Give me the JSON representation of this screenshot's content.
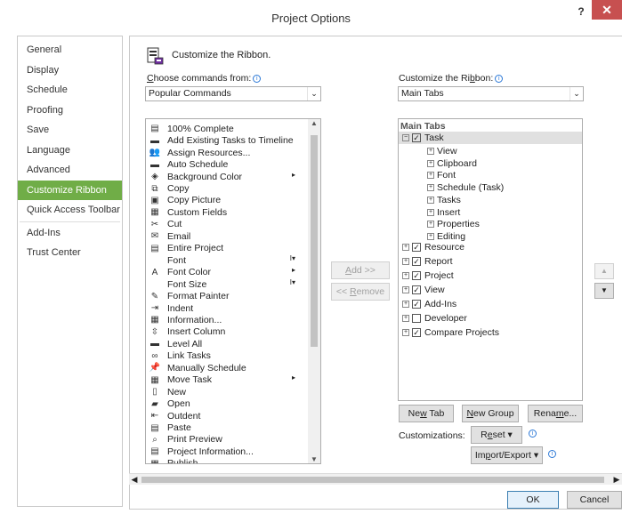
{
  "window": {
    "title": "Project Options",
    "help": "?",
    "close": "✕"
  },
  "nav": {
    "items": [
      "General",
      "Display",
      "Schedule",
      "Proofing",
      "Save",
      "Language",
      "Advanced",
      "Customize Ribbon",
      "Quick Access Toolbar",
      "Add-Ins",
      "Trust Center"
    ],
    "selected": "Customize Ribbon"
  },
  "header": {
    "title": "Customize the Ribbon."
  },
  "choose": {
    "label_pre": "",
    "label_u": "C",
    "label_post": "hoose commands from:",
    "info": "i",
    "value": "Popular Commands"
  },
  "customize": {
    "label_pre": "Customize the Ri",
    "label_u": "b",
    "label_post": "bon:",
    "info": "i",
    "value": "Main Tabs"
  },
  "commands": [
    {
      "label": "100% Complete",
      "icon": "progress-icon"
    },
    {
      "label": "Add Existing Tasks to Timeline",
      "icon": "timeline-icon"
    },
    {
      "label": "Assign Resources...",
      "icon": "resources-icon"
    },
    {
      "label": "Auto Schedule",
      "icon": "auto-schedule-icon"
    },
    {
      "label": "Background Color",
      "icon": "paint-bucket-icon",
      "sub": "▸"
    },
    {
      "label": "Copy",
      "icon": "copy-icon"
    },
    {
      "label": "Copy Picture",
      "icon": "copy-picture-icon"
    },
    {
      "label": "Custom Fields",
      "icon": "custom-fields-icon"
    },
    {
      "label": "Cut",
      "icon": "scissors-icon"
    },
    {
      "label": "Email",
      "icon": "email-icon"
    },
    {
      "label": "Entire Project",
      "icon": "entire-project-icon"
    },
    {
      "label": "Font",
      "icon": "font-icon",
      "sub": "I▾"
    },
    {
      "label": "Font Color",
      "icon": "font-color-icon",
      "sub": "▸"
    },
    {
      "label": "Font Size",
      "icon": "font-size-icon",
      "sub": "I▾"
    },
    {
      "label": "Format Painter",
      "icon": "format-painter-icon"
    },
    {
      "label": "Indent",
      "icon": "indent-icon"
    },
    {
      "label": "Information...",
      "icon": "information-icon"
    },
    {
      "label": "Insert Column",
      "icon": "insert-column-icon"
    },
    {
      "label": "Level All",
      "icon": "level-all-icon"
    },
    {
      "label": "Link Tasks",
      "icon": "link-icon"
    },
    {
      "label": "Manually Schedule",
      "icon": "pin-icon"
    },
    {
      "label": "Move Task",
      "icon": "move-task-icon",
      "sub": "▸"
    },
    {
      "label": "New",
      "icon": "new-doc-icon"
    },
    {
      "label": "Open",
      "icon": "folder-icon"
    },
    {
      "label": "Outdent",
      "icon": "outdent-icon"
    },
    {
      "label": "Paste",
      "icon": "paste-icon"
    },
    {
      "label": "Print Preview",
      "icon": "print-preview-icon"
    },
    {
      "label": "Project Information...",
      "icon": "project-info-icon"
    },
    {
      "label": "Publish",
      "icon": "publish-icon"
    }
  ],
  "middle": {
    "add_u": "A",
    "add_post": "dd >>",
    "remove_pre": "<< ",
    "remove_u": "R",
    "remove_post": "emove"
  },
  "tree": {
    "header": "Main Tabs",
    "task": {
      "label": "Task",
      "checked": true,
      "expander": "⊟"
    },
    "task_groups": [
      "View",
      "Clipboard",
      "Font",
      "Schedule (Task)",
      "Tasks",
      "Insert",
      "Properties",
      "Editing"
    ],
    "tabs": [
      {
        "label": "Resource",
        "checked": true
      },
      {
        "label": "Report",
        "checked": true
      },
      {
        "label": "Project",
        "checked": true
      },
      {
        "label": "View",
        "checked": true
      },
      {
        "label": "Add-Ins",
        "checked": true
      },
      {
        "label": "Developer",
        "checked": false
      },
      {
        "label": "Compare Projects",
        "checked": true
      }
    ]
  },
  "bottom": {
    "new_tab_pre": "Ne",
    "new_tab_u": "w",
    "new_tab_post": " Tab",
    "new_group_pre": "",
    "new_group_u": "N",
    "new_group_post": "ew Group",
    "rename_pre": "Rena",
    "rename_u": "m",
    "rename_post": "e...",
    "customizations_label": "Customizations:",
    "reset_pre": "R",
    "reset_u": "e",
    "reset_post": "set ▾",
    "import_pre": "Im",
    "import_u": "p",
    "import_post": "ort/Export ▾",
    "info": "i"
  },
  "footer": {
    "ok": "OK",
    "cancel": "Cancel"
  }
}
